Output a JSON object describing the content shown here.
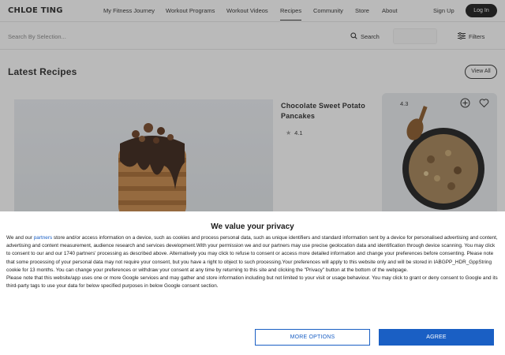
{
  "brand": {
    "logo": "CHLOE TING"
  },
  "nav": {
    "links": [
      "My Fitness Journey",
      "Workout Programs",
      "Workout Videos",
      "Recipes",
      "Community",
      "Store",
      "About"
    ],
    "active": "Recipes",
    "signup": "Sign Up",
    "login": "Log In"
  },
  "search": {
    "placeholder": "Search By Selection...",
    "button": "Search",
    "filters": "Filters"
  },
  "section": {
    "title": "Latest Recipes",
    "view_all": "View All"
  },
  "cards": [
    {
      "title": "Chocolate Sweet Potato Pancakes",
      "rating": "4.1"
    },
    {
      "rating": "4.3"
    }
  ],
  "consent": {
    "title": "We value your privacy",
    "p1_before": "We and our ",
    "p1_link": "partners",
    "p1_after": " store and/or access information on a device, such as cookies and process personal data, such as unique identifiers and standard information sent by a device for personalised advertising and content, advertising and content measurement, audience research and services development.With your permission we and our partners may use precise geolocation data and identification through device scanning. You may click to consent to our and our 1740 partners' processing as described above. Alternatively you may click to refuse to consent or access more detailed information and change your preferences before consenting. Please note that some processing of your personal data may not require your consent, but you have a right to object to such processing.Your preferences will apply to this website only and will be stored in IABGPP_HDR_GppString cookie for 13 months. You can change your preferences or withdraw your consent at any time by returning to this site and clicking the \"Privacy\" button at the bottom of the webpage.",
    "p2": "Please note that this website/app uses one or more Google services and may gather and store information including but not limited to your visit or usage behaviour. You may click to grant or deny consent to Google and its third-party tags to use your data for below specified purposes in below Google consent section.",
    "more_options": "MORE OPTIONS",
    "agree": "AGREE"
  },
  "colors": {
    "accent": "#1a5fc4",
    "dark": "#1d1d1d",
    "overlay": "rgba(40,40,40,0.32)"
  }
}
